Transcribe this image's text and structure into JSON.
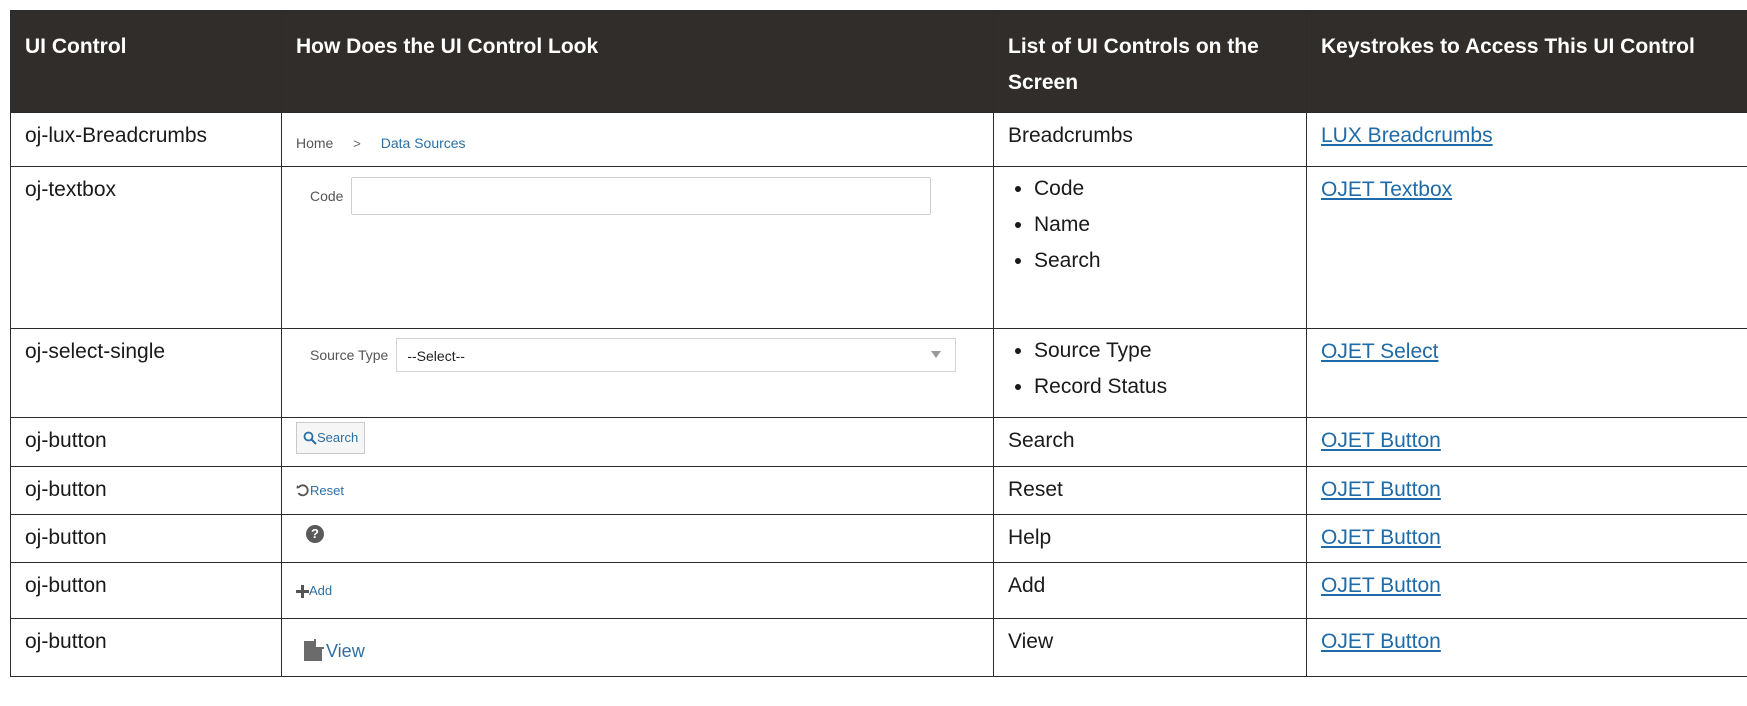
{
  "headers": {
    "control": "UI Control",
    "look": "How Does the UI Control Look",
    "list": "List of UI Controls on the Screen",
    "keys": "Keystrokes to Access This UI Control"
  },
  "rows": [
    {
      "control": "oj-lux-Breadcrumbs",
      "list": [
        "Breadcrumbs"
      ],
      "link": "LUX Breadcrumbs",
      "look": {
        "home": "Home",
        "separator": ">",
        "current": "Data Sources"
      }
    },
    {
      "control": "oj-textbox",
      "list": [
        "Code",
        "Name",
        "Search"
      ],
      "link": "OJET Textbox",
      "look": {
        "label": "Code",
        "value": ""
      }
    },
    {
      "control": "oj-select-single",
      "list": [
        "Source Type",
        "Record Status"
      ],
      "link": "OJET Select",
      "look": {
        "label": "Source Type",
        "value": "--Select--"
      }
    },
    {
      "control": "oj-button",
      "list": [
        "Search"
      ],
      "link": "OJET Button",
      "look": {
        "label": "Search",
        "icon": "search-icon"
      }
    },
    {
      "control": "oj-button",
      "list": [
        "Reset"
      ],
      "link": "OJET Button",
      "look": {
        "label": "Reset",
        "icon": "reset-icon"
      }
    },
    {
      "control": "oj-button",
      "list": [
        "Help"
      ],
      "link": "OJET Button",
      "look": {
        "label": "?",
        "icon": "help-icon"
      }
    },
    {
      "control": "oj-button",
      "list": [
        "Add"
      ],
      "link": "OJET Button",
      "look": {
        "label": "Add",
        "icon": "plus-icon"
      }
    },
    {
      "control": "oj-button",
      "list": [
        "View"
      ],
      "link": "OJET Button",
      "look": {
        "label": "View",
        "icon": "view-icon"
      }
    }
  ],
  "colors": {
    "header_bg": "#312d2a",
    "link": "#1f6aa8",
    "control_blue": "#2d6fa3"
  }
}
